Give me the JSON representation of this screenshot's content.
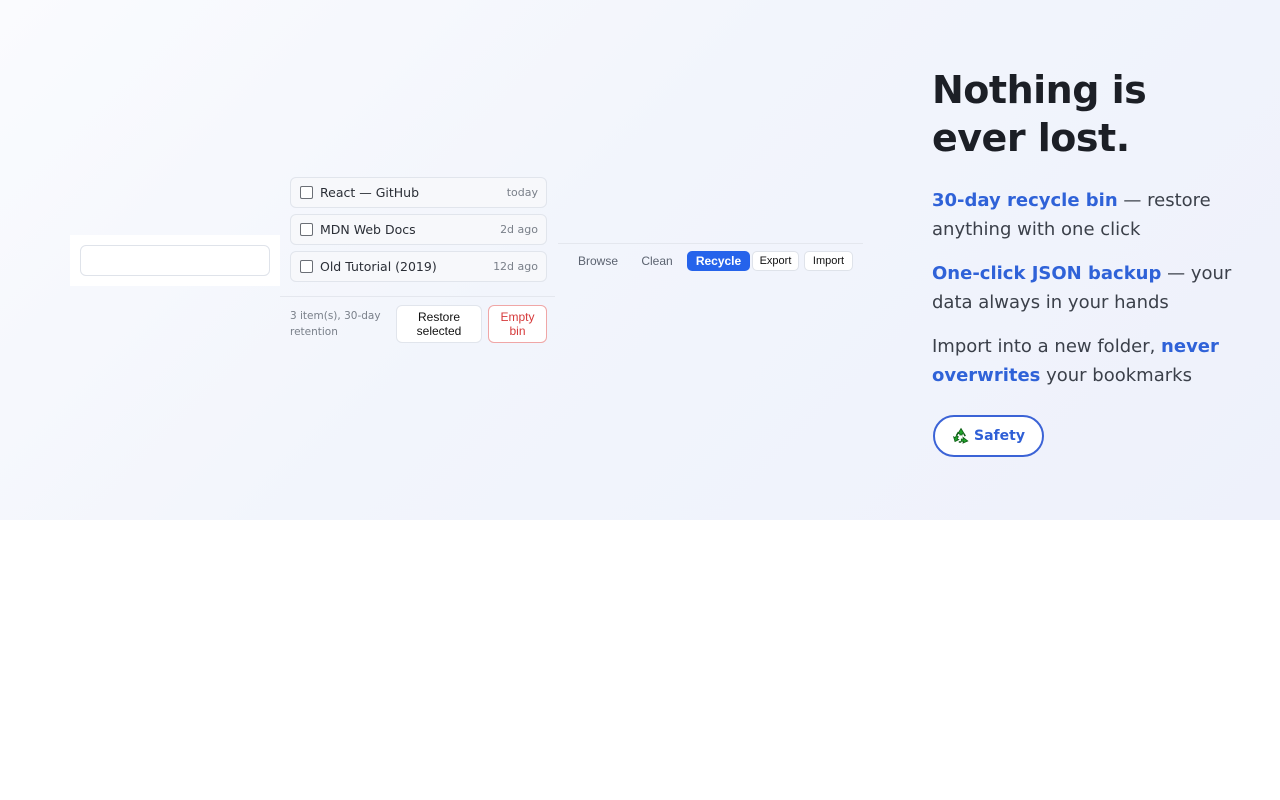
{
  "search": {
    "placeholder": ""
  },
  "recycle": {
    "items": [
      {
        "title": "React — GitHub",
        "age": "today"
      },
      {
        "title": "MDN Web Docs",
        "age": "2d ago"
      },
      {
        "title": "Old Tutorial (2019)",
        "age": "12d ago"
      }
    ],
    "footer": {
      "summary": "3 item(s), 30-day retention",
      "restore_label": "Restore selected",
      "empty_label": "Empty bin"
    }
  },
  "tabs": [
    {
      "label": "Browse",
      "active": false
    },
    {
      "label": "Clean",
      "active": false
    },
    {
      "label": "Recycle",
      "active": true
    },
    {
      "label": "Export",
      "active": false
    },
    {
      "label": "Import",
      "active": false
    }
  ],
  "hero": {
    "headline": "Nothing is ever lost.",
    "points": [
      {
        "highlight": "30-day recycle bin",
        "rest": " — restore anything with one click"
      },
      {
        "highlight": "One-click JSON backup",
        "rest": " — your data always in your hands"
      },
      {
        "lead": "Import into a new folder, ",
        "highlight": "never overwrites",
        "rest": " your bookmarks"
      }
    ],
    "badge": {
      "icon": "recycle-icon",
      "label": "Safety"
    }
  },
  "colors": {
    "accent": "#2563eb",
    "danger": "#d6393a",
    "badge_icon": "#1fa32a"
  }
}
